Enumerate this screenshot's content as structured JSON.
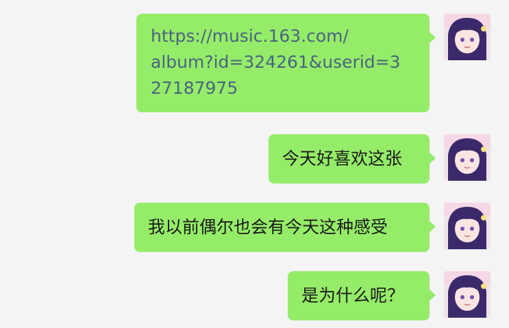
{
  "chat": {
    "messages": [
      {
        "sender": "me",
        "type": "link",
        "text": "https://music.163.com/\nalbum?id=324261&userid=3\n27187975"
      },
      {
        "sender": "me",
        "type": "text",
        "text": "今天好喜欢这张"
      },
      {
        "sender": "me",
        "type": "text",
        "text": "我以前偶尔也会有今天这种感受"
      },
      {
        "sender": "me",
        "type": "text",
        "text": "是为什么呢？"
      }
    ],
    "avatar": {
      "icon": "anime-girl-avatar",
      "hair_color": "#3b2a6b",
      "bg_color": "#efe3ea"
    },
    "colors": {
      "bubble": "#95ec69",
      "link": "#4a6480",
      "background": "#f4f4f5"
    }
  }
}
